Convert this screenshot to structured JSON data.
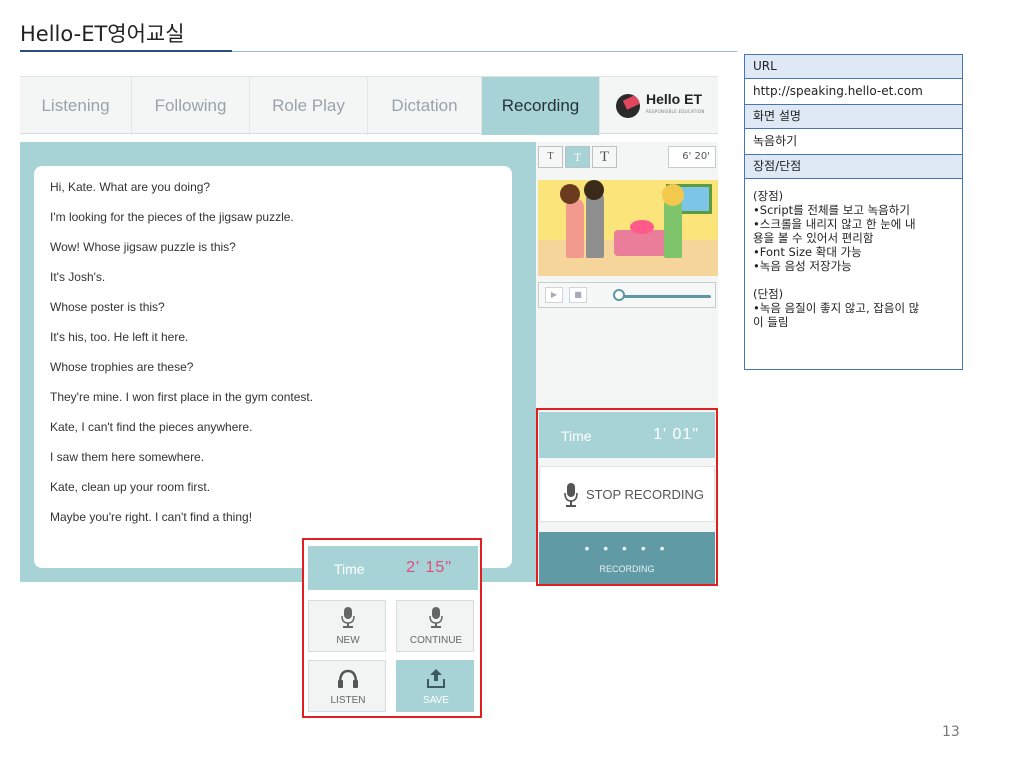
{
  "slide": {
    "title": "Hello-ET영어교실",
    "page_number": "13"
  },
  "app": {
    "tabs": [
      "Listening",
      "Following",
      "Role Play",
      "Dictation",
      "Recording"
    ],
    "active_tab": "Recording",
    "logo": {
      "name": "Hello ET",
      "subtitle": "RESPONSIBLE EDUCATION"
    },
    "font_sizes": [
      "T",
      "T",
      "T"
    ],
    "duration": "6' 20'",
    "script_lines": [
      "Hi, Kate. What are you doing?",
      "I'm looking for the pieces of the jigsaw puzzle.",
      "Wow! Whose jigsaw puzzle is this?",
      "It's Josh's.",
      "Whose poster is this?",
      "It's his, too. He left it here.",
      "Whose trophies are these?",
      "They're mine. I won first place in the gym contest.",
      "Kate, I can't find the pieces anywhere.",
      "I saw them here somewhere.",
      "Kate, clean up your room first.",
      "Maybe you're right. I can't find a thing!"
    ],
    "player": {
      "play": "▶",
      "stop": "■"
    },
    "recording_panel": {
      "time_label": "Time",
      "time_value": "1' 01\"",
      "stop_label": "STOP RECORDING",
      "status_dots": "• • • • •",
      "status_label": "RECORDING"
    },
    "controls_panel": {
      "time_label": "Time",
      "time_value": "2' 15\"",
      "new_label": "NEW",
      "continue_label": "CONTINUE",
      "listen_label": "LISTEN",
      "save_label": "SAVE"
    }
  },
  "info_table": {
    "url_header": "URL",
    "url_value": "http://speaking.hello-et.com",
    "desc_header": "화면 설명",
    "desc_value": "녹음하기",
    "proscons_header": "장점/단점",
    "pros_title": "(장점)",
    "pros": [
      "•Script를 전체를 보고 녹음하기",
      "•스크롤을 내리지 않고 한 눈에 내",
      "용을 볼 수 있어서 편리함",
      "•Font Size 확대 가능",
      "•녹음 음성 저장가능"
    ],
    "cons_title": "(단점)",
    "cons": [
      "•녹음 음질이 좋지 않고, 잡음이 많",
      "이 들림"
    ]
  },
  "colors": {
    "accent_teal": "#a7d3d7",
    "dark_teal": "#5f9aa5",
    "highlight_red": "#e02020",
    "time_pink": "#e24a7a",
    "table_border": "#4a74b8"
  }
}
